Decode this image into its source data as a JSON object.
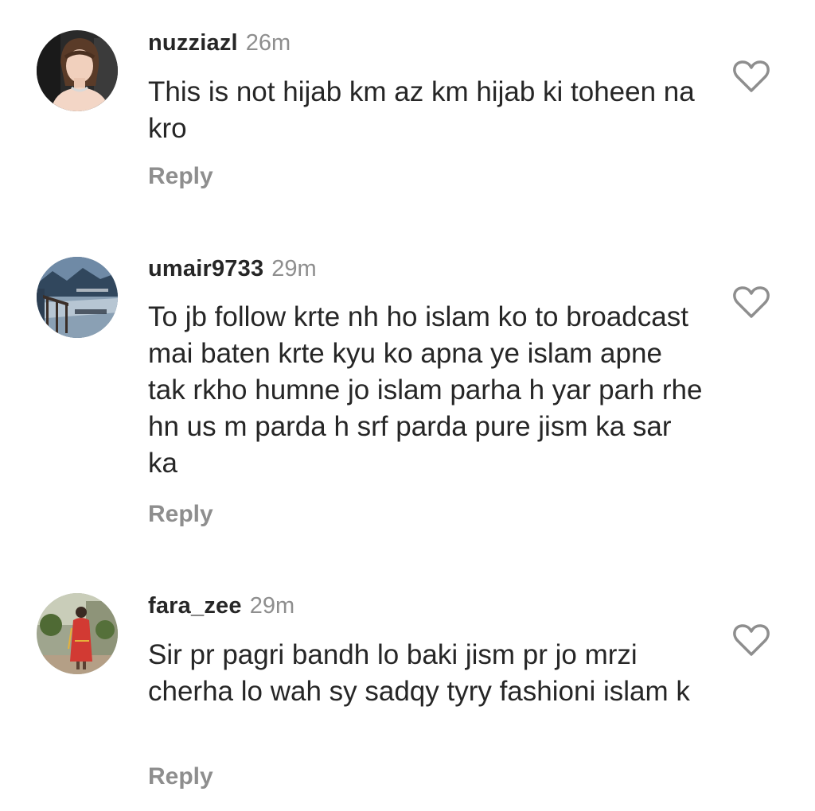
{
  "comments": [
    {
      "username": "nuzziazl",
      "time": "26m",
      "text": "This is not hijab km az km hijab ki toheen na kro",
      "reply_label": "Reply",
      "avatar_icon": "profile-photo-woman",
      "like_icon": "heart-outline-icon"
    },
    {
      "username": "umair9733",
      "time": "29m",
      "text": "To jb follow krte nh ho islam ko to broadcast mai baten krte kyu ko apna ye islam apne tak rkho humne jo islam parha h yar parh rhe hn us m parda h srf parda pure jism ka sar ka",
      "reply_label": "Reply",
      "avatar_icon": "profile-photo-landscape",
      "like_icon": "heart-outline-icon"
    },
    {
      "username": "fara_zee",
      "time": "29m",
      "text": "Sir pr pagri bandh lo baki jism pr jo mrzi cherha lo wah sy sadqy tyry fashioni islam k",
      "reply_label": "Reply",
      "avatar_icon": "profile-photo-girl-red-dress",
      "like_icon": "heart-outline-icon"
    }
  ],
  "colors": {
    "text": "#262626",
    "secondary": "#8e8e8e",
    "background": "#ffffff"
  }
}
